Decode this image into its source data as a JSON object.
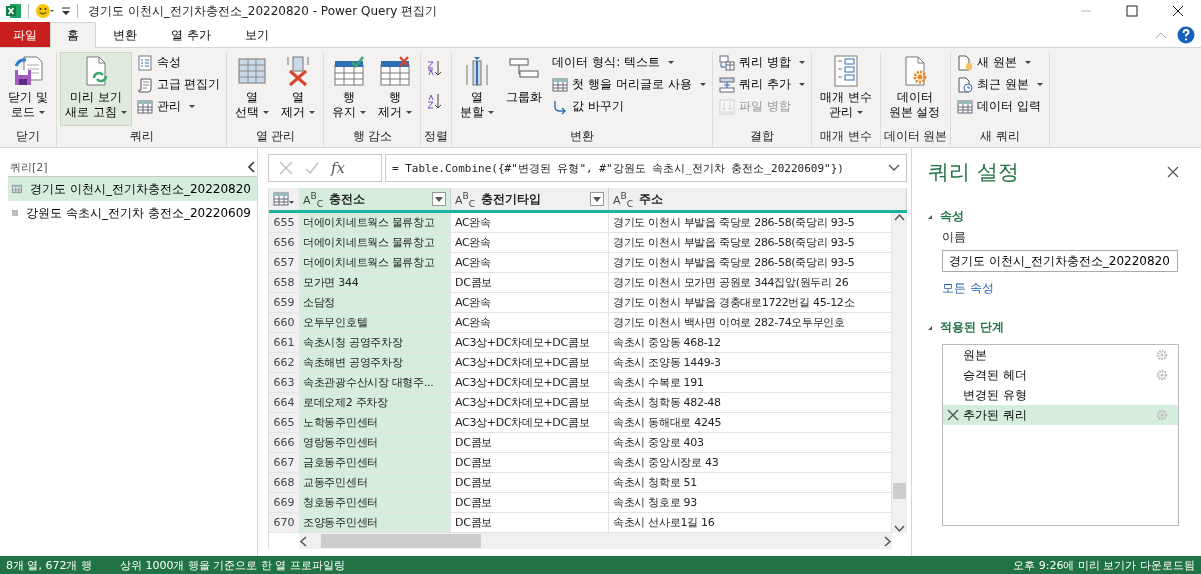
{
  "window": {
    "title": "경기도 이천시_전기차충전소_20220820 - Power Query 편집기"
  },
  "tabs": [
    {
      "label": "파일",
      "kind": "file",
      "selected": false
    },
    {
      "label": "홈",
      "kind": "tab",
      "selected": true
    },
    {
      "label": "변환",
      "kind": "tab",
      "selected": false
    },
    {
      "label": "열 추가",
      "kind": "tab",
      "selected": false
    },
    {
      "label": "보기",
      "kind": "tab",
      "selected": false
    }
  ],
  "ribbon": [
    {
      "title": "닫기",
      "columns": [
        [
          {
            "label": "닫기 및\n로드",
            "kind": "large",
            "dropdown": true,
            "disabled": false,
            "highlighted": false
          }
        ]
      ]
    },
    {
      "title": "쿼리",
      "columns": [
        [
          {
            "label": "미리 보기\n새로 고침",
            "kind": "large",
            "dropdown": true,
            "disabled": false,
            "highlighted": true
          }
        ],
        [
          {
            "label": "속성",
            "kind": "small",
            "dropdown": false,
            "disabled": false,
            "highlighted": false
          },
          {
            "label": "고급 편집기",
            "kind": "small",
            "dropdown": false,
            "disabled": false,
            "highlighted": false
          },
          {
            "label": "관리",
            "kind": "small",
            "dropdown": true,
            "disabled": false,
            "highlighted": false
          }
        ]
      ]
    },
    {
      "title": "열 관리",
      "columns": [
        [
          {
            "label": "열\n선택",
            "kind": "large",
            "dropdown": true,
            "disabled": false,
            "highlighted": false
          }
        ],
        [
          {
            "label": "열\n제거",
            "kind": "large",
            "dropdown": true,
            "disabled": false,
            "highlighted": false
          }
        ]
      ]
    },
    {
      "title": "행 감소",
      "columns": [
        [
          {
            "label": "행\n유지",
            "kind": "large",
            "dropdown": true,
            "disabled": false,
            "highlighted": false
          }
        ],
        [
          {
            "label": "행\n제거",
            "kind": "large",
            "dropdown": true,
            "disabled": false,
            "highlighted": false
          }
        ]
      ]
    },
    {
      "title": "정렬",
      "columns": [
        [
          {
            "kind": "icon",
            "dropdown": false,
            "disabled": false,
            "highlighted": false
          },
          {
            "kind": "icon",
            "dropdown": false,
            "disabled": false,
            "highlighted": false
          }
        ]
      ]
    },
    {
      "title": "변환",
      "columns": [
        [
          {
            "label": "열\n분할",
            "kind": "large",
            "dropdown": true,
            "disabled": false,
            "highlighted": false
          }
        ],
        [
          {
            "label": "그룹화",
            "kind": "large",
            "dropdown": false,
            "disabled": false,
            "highlighted": false
          }
        ],
        [
          {
            "label": "데이터 형식: 텍스트",
            "kind": "text",
            "dropdown": true,
            "disabled": false,
            "highlighted": false
          },
          {
            "label": "첫 행을 머리글로 사용",
            "kind": "small",
            "dropdown": true,
            "disabled": false,
            "highlighted": false
          },
          {
            "label": "값 바꾸기",
            "kind": "small",
            "dropdown": false,
            "disabled": false,
            "highlighted": false
          }
        ]
      ]
    },
    {
      "title": "결합",
      "columns": [
        [
          {
            "label": "쿼리 병합",
            "kind": "small",
            "dropdown": true,
            "disabled": false,
            "highlighted": false
          },
          {
            "label": "쿼리 추가",
            "kind": "small",
            "dropdown": true,
            "disabled": false,
            "highlighted": false
          },
          {
            "label": "파일 병합",
            "kind": "small",
            "dropdown": false,
            "disabled": true,
            "highlighted": false
          }
        ]
      ]
    },
    {
      "title": "매개 변수",
      "columns": [
        [
          {
            "label": "매개 변수\n관리",
            "kind": "large",
            "dropdown": true,
            "disabled": false,
            "highlighted": false
          }
        ]
      ]
    },
    {
      "title": "데이터 원본",
      "columns": [
        [
          {
            "label": "데이터\n원본 설정",
            "kind": "large",
            "dropdown": false,
            "disabled": false,
            "highlighted": false
          }
        ]
      ]
    },
    {
      "title": "새 쿼리",
      "columns": [
        [
          {
            "label": "새 원본",
            "kind": "small",
            "dropdown": true,
            "disabled": false,
            "highlighted": false
          },
          {
            "label": "최근 원본",
            "kind": "small",
            "dropdown": true,
            "disabled": false,
            "highlighted": false
          },
          {
            "label": "데이터 입력",
            "kind": "small",
            "dropdown": false,
            "disabled": false,
            "highlighted": false
          }
        ]
      ]
    }
  ],
  "queries": {
    "heading": "쿼리[2]",
    "items": [
      {
        "name": "경기도 이천시_전기차충전소_20220820",
        "selected": true
      },
      {
        "name": "강원도 속초시_전기차 충전소_20220609",
        "selected": false
      }
    ]
  },
  "formula_bar": {
    "fx": "fx",
    "formula": "= Table.Combine({#\"변경된 유형\", #\"강원도 속초시_전기차 충전소_20220609\"})"
  },
  "table": {
    "columns": [
      {
        "name": "충전소",
        "type": "A$^{B}$$_{C}$",
        "selected": true
      },
      {
        "name": "충전기타입",
        "type": "A$^{B}$$_{C}$",
        "selected": false
      },
      {
        "name": "주소",
        "type": "A$^{B}$$_{C}$",
        "selected": false
      }
    ],
    "rows": [
      {
        "number": "655",
        "cells": [
          "더에이치네트웍스 물류창고",
          "AC완속",
          "경기도 이천시 부발읍 죽당로 286-58(죽당리 93-5"
        ]
      },
      {
        "number": "656",
        "cells": [
          "더에이치네트웍스 물류창고",
          "AC완속",
          "경기도 이천시 부발읍 죽당로 286-58(죽당리 93-5"
        ]
      },
      {
        "number": "657",
        "cells": [
          "더에이치네트웍스 물류창고",
          "AC완속",
          "경기도 이천시 부발읍 죽당로 286-58(죽당리 93-5"
        ]
      },
      {
        "number": "658",
        "cells": [
          "모가면 344",
          "DC콤보",
          "경기도 이천시 모가면 공원로 344집앞(원두리 26"
        ]
      },
      {
        "number": "659",
        "cells": [
          "소담정",
          "AC완속",
          "경기도 이천시 부발읍 경충대로1722번길 45-12소"
        ]
      },
      {
        "number": "660",
        "cells": [
          "오투무인호텔",
          "AC완속",
          "경기도 이천시 백사면 이여로 282-74오투무인호"
        ]
      },
      {
        "number": "661",
        "cells": [
          "속초시청 공영주차장",
          "AC3상+DC차데모+DC콤보",
          "속초시 중앙동 468-12"
        ]
      },
      {
        "number": "662",
        "cells": [
          "속초해변 공영주차장",
          "AC3상+DC차데모+DC콤보",
          "속초시 조양동 1449-3"
        ]
      },
      {
        "number": "663",
        "cells": [
          "속초관광수산시장 대형주...",
          "AC3상+DC차데모+DC콤보",
          "속초시 수복로 191"
        ]
      },
      {
        "number": "664",
        "cells": [
          "로데오제2 주차장",
          "AC3상+DC차데모+DC콤보",
          "속초시 청학동 482-48"
        ]
      },
      {
        "number": "665",
        "cells": [
          "노학동주민센터",
          "AC3상+DC차데모+DC콤보",
          "속초시 동해대로 4245"
        ]
      },
      {
        "number": "666",
        "cells": [
          "영랑동주민센터",
          "DC콤보",
          "속초시 중앙로 403"
        ]
      },
      {
        "number": "667",
        "cells": [
          "금호동주민센터",
          "DC콤보",
          "속초시 중앙시장로 43"
        ]
      },
      {
        "number": "668",
        "cells": [
          "교동주민센터",
          "DC콤보",
          "속초시 청학로 51"
        ]
      },
      {
        "number": "669",
        "cells": [
          "청호동주민센터",
          "DC콤보",
          "속초시 청호로 93"
        ]
      },
      {
        "number": "670",
        "cells": [
          "조양동주민센터",
          "DC콤보",
          "속초시 선사로1길 16"
        ]
      }
    ]
  },
  "settings": {
    "title": "쿼리 설정",
    "properties": {
      "heading": "속성",
      "expanded": true,
      "name_label": "이름",
      "name_value": "경기도 이천시_전기차충전소_20220820",
      "all_properties": "모든 속성"
    },
    "steps": {
      "heading": "적용된 단계",
      "expanded": true,
      "items": [
        {
          "name": "원본",
          "settings": true,
          "selected": false
        },
        {
          "name": "승격된 헤더",
          "settings": true,
          "selected": false
        },
        {
          "name": "변경된 유형",
          "settings": false,
          "selected": false
        },
        {
          "name": "추가된 쿼리",
          "settings": true,
          "selected": true
        }
      ]
    }
  },
  "status_bar": {
    "left": [
      "8개 열, 672개 행",
      "상위 1000개 행을 기준으로 한 열 프로파일링"
    ],
    "right": "오후 9:26에 미리 보기가 다운로드됨"
  }
}
